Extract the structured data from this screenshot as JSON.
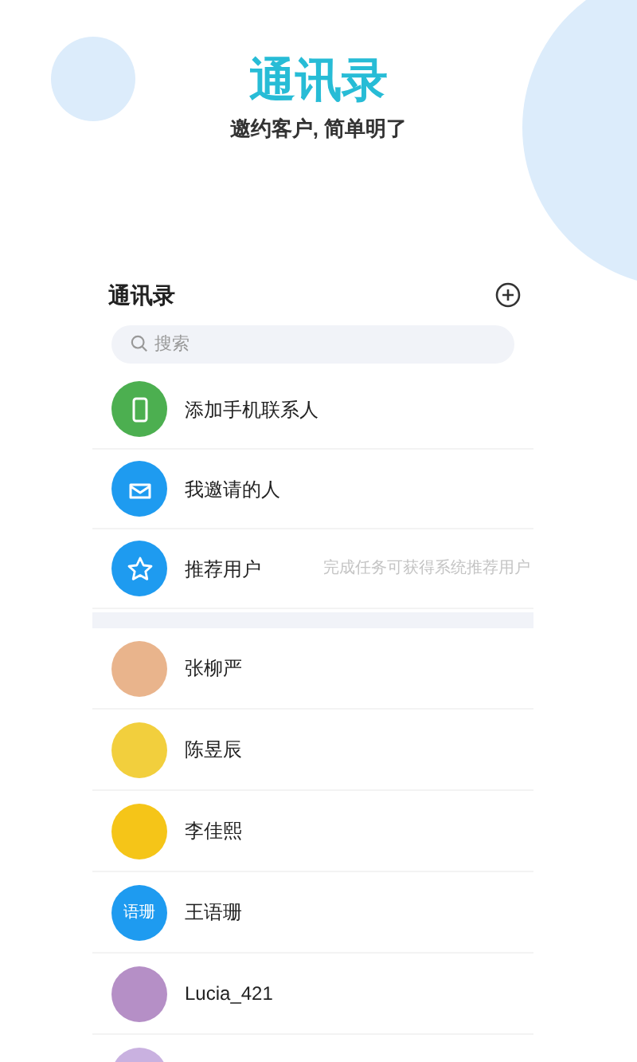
{
  "hero": {
    "title": "通讯录",
    "subtitle": "邀约客户, 简单明了"
  },
  "card": {
    "title": "通讯录",
    "search": {
      "placeholder": "搜索"
    },
    "entries": [
      {
        "kind": "phone",
        "label": "添加手机联系人"
      },
      {
        "kind": "mail",
        "label": "我邀请的人"
      },
      {
        "kind": "star",
        "label": "推荐用户",
        "hint": "完成任务可获得系统推荐用户"
      }
    ],
    "contacts": [
      {
        "kind": "photo",
        "name": "张柳严"
      },
      {
        "kind": "photo",
        "name": "陈昱辰"
      },
      {
        "kind": "photo",
        "name": "李佳熙"
      },
      {
        "kind": "initials",
        "initials": "语珊",
        "name": "王语珊"
      },
      {
        "kind": "photo",
        "name": "Lucia_421"
      },
      {
        "kind": "photo"
      }
    ]
  }
}
